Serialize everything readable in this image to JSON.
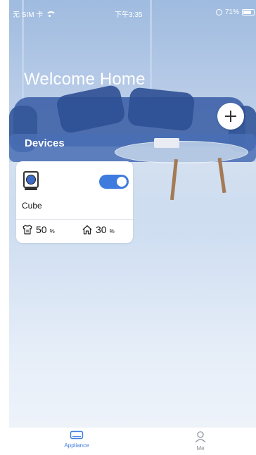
{
  "status_bar": {
    "carrier": "无 SIM 卡",
    "time": "下午3:35",
    "battery": "71%",
    "icons": [
      "wifi-icon",
      "lock-rotation-icon",
      "battery-icon"
    ]
  },
  "header": {
    "welcome": "Welcome Home",
    "add_icon": "plus-icon"
  },
  "devices": {
    "title": "Devices",
    "items": [
      {
        "name": "Cube",
        "icon": "dehumidifier-icon",
        "power_on": true,
        "stats": [
          {
            "icon": "shirt-icon",
            "value": "50",
            "unit": "%"
          },
          {
            "icon": "home-icon",
            "value": "30",
            "unit": "%"
          }
        ]
      }
    ]
  },
  "tab_bar": {
    "tabs": [
      {
        "label": "Appliance",
        "icon": "appliance-icon",
        "active": true
      },
      {
        "label": "Me",
        "icon": "person-icon",
        "active": false
      }
    ]
  },
  "colors": {
    "accent": "#3f7bdf",
    "card_bg": "#ffffff",
    "text_primary": "#111111"
  }
}
